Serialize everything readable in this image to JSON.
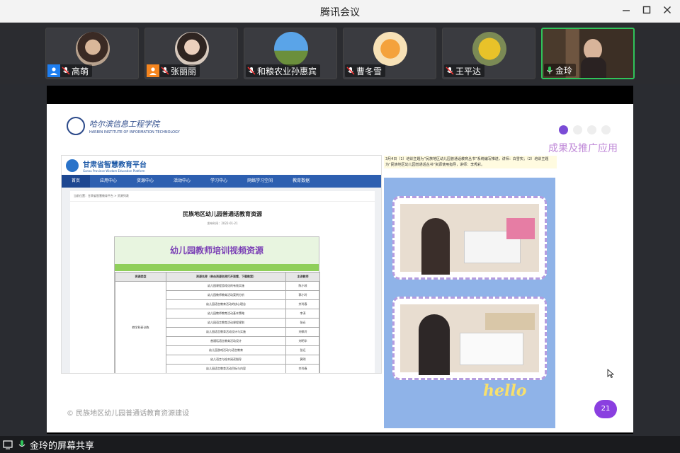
{
  "window": {
    "title": "腾讯会议"
  },
  "participants": [
    {
      "name": "高萌",
      "user_icon": "blue",
      "mic": "muted"
    },
    {
      "name": "张丽丽",
      "user_icon": "orange",
      "mic": "muted"
    },
    {
      "name": "和粮农业孙惠宾",
      "user_icon": null,
      "mic": "muted"
    },
    {
      "name": "曹冬雪",
      "user_icon": null,
      "mic": "muted"
    },
    {
      "name": "王平达",
      "user_icon": null,
      "mic": "muted"
    },
    {
      "name": "金玲",
      "user_icon": null,
      "mic": "active",
      "speaking": true
    }
  ],
  "slide": {
    "logo_cn": "哈尔滨信息工程学院",
    "logo_en": "HARBIN INSTITUTE OF INFORMATION TECHNOLOGY",
    "heading": "成果及推广应用",
    "footer": "© 民族地区幼儿园普通话教育资源建设",
    "page_number": "21",
    "web": {
      "brand_cn": "甘肃省智慧教育平台",
      "brand_en": "Gansu Province Wisdom Education Platform",
      "nav": [
        "首页",
        "应用中心",
        "资源中心",
        "活动中心",
        "学习中心",
        "网络学习空间",
        "教育数据"
      ],
      "crumb": "当前位置：甘肃省智慧教育平台 > 资源列表",
      "article_title": "民族地区幼儿园普通话教育资源",
      "article_date": "发布时间：2022-01-21",
      "banner_title": "幼儿园教师培训视频资源",
      "table_headers": [
        "资源类型",
        "资源名称（单击资源名称打开观看、下载教案）",
        "主讲教师"
      ],
      "table_category": "教学科研训练",
      "table_rows": [
        [
          "幼儿园课程游戏化的有效实施",
          "陈小琼"
        ],
        [
          "幼儿园教师教育活动案例分析",
          "郭小玲"
        ],
        [
          "幼儿园语言教育活动的核心理念",
          "余玲春"
        ],
        [
          "幼儿园教师教育活动基本策略",
          "李涛"
        ],
        [
          "幼儿园语言教育活动课程规划",
          "张迁"
        ],
        [
          "幼儿园语言教育活动设计与实施",
          "刘佩玲"
        ],
        [
          "普通话语言教育活动设计",
          "刘明华"
        ],
        [
          "幼儿园游戏活动与语言教育",
          "张迁"
        ],
        [
          "幼儿语言与绘本阅读指导",
          "黄明"
        ],
        [
          "幼儿园语言教育活动目标与内容",
          "余玲春"
        ]
      ]
    },
    "caption": "3月4日（1）培训主题为“民族地区幼儿园普通话教育丛书”系统编写推进，讲师：白雪实；（2）培训主题为“民族地区幼儿园普通话丛书”资源使用指导，讲师：李秀彩。",
    "photo_text": "hello"
  },
  "statusbar": {
    "text": "金玲的屏幕共享"
  },
  "colors": {
    "accent_green": "#2fc45a",
    "brand_blue": "#2d5fb0",
    "purple": "#8a3fe0"
  }
}
